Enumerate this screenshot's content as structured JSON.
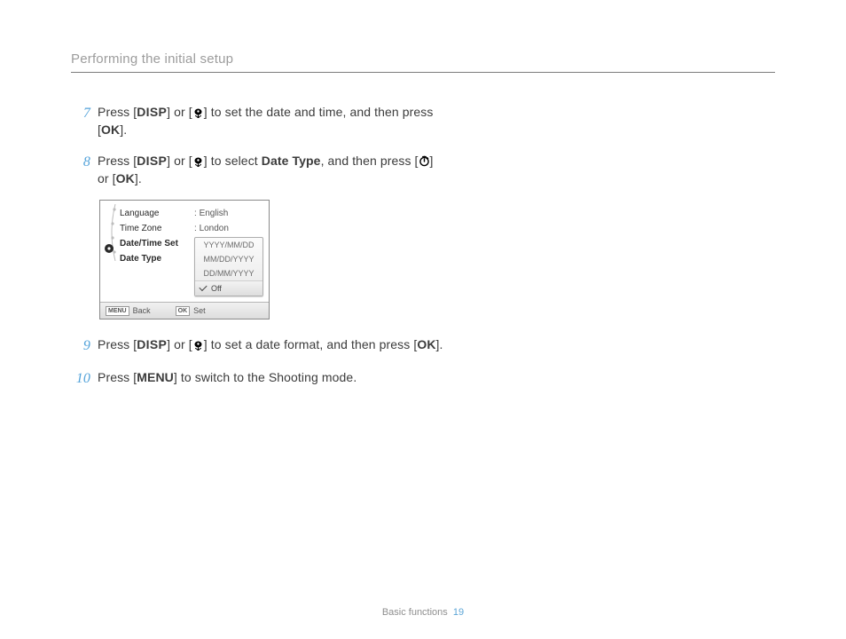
{
  "header": {
    "section_title": "Performing the initial setup"
  },
  "glyph": {
    "disp": "DISP",
    "ok": "OK",
    "menu": "MENU"
  },
  "labels": {
    "date_type": "Date Type"
  },
  "steps": {
    "seven": {
      "num": "7",
      "a": "Press [",
      "b": "] or [",
      "c": "] to set the date and time, and then press [",
      "d": "]."
    },
    "eight": {
      "num": "8",
      "a": "Press [",
      "b": "] or [",
      "c": "] to select ",
      "d": ", and then press [",
      "e": "] or [",
      "f": "]."
    },
    "nine": {
      "num": "9",
      "a": "Press [",
      "b": "] or [",
      "c": "] to set a date format, and then press [",
      "d": "]."
    },
    "ten": {
      "num": "10",
      "a": "Press [",
      "b": "] to switch to the Shooting mode."
    }
  },
  "panel": {
    "menu_items": {
      "language": "Language",
      "timezone": "Time Zone",
      "datetime": "Date/Time Set",
      "datetype": "Date Type"
    },
    "values": {
      "language": "English",
      "timezone": "London",
      "colon": ":"
    },
    "options": {
      "opt1": "YYYY/MM/DD",
      "opt2": "MM/DD/YYYY",
      "opt3": "DD/MM/YYYY",
      "opt4": "Off"
    },
    "footer": {
      "menu_tag": "MENU",
      "back": "Back",
      "ok_tag": "OK",
      "set": "Set"
    }
  },
  "footer": {
    "label": "Basic functions",
    "page": "19"
  }
}
